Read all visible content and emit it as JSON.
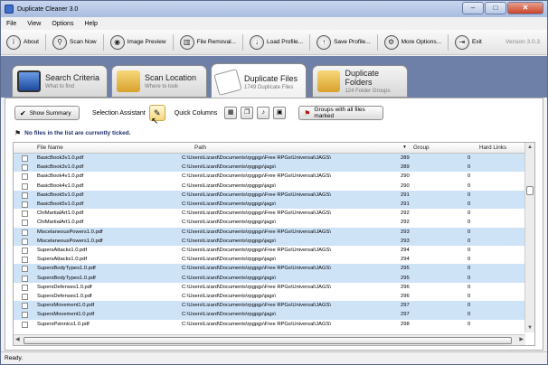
{
  "window": {
    "title": "Duplicate Cleaner 3.0",
    "buttons": [
      "–",
      "□",
      "✕"
    ]
  },
  "menu": [
    "File",
    "View",
    "Options",
    "Help"
  ],
  "toolbar": {
    "items": [
      {
        "label": "About",
        "icon": "info-icon"
      },
      {
        "label": "Scan Now",
        "icon": "magnifier-icon"
      },
      {
        "label": "Image Preview",
        "icon": "eye-icon"
      },
      {
        "label": "File Removal...",
        "icon": "trash-icon"
      },
      {
        "label": "Load Profile...",
        "icon": "down-arrow-icon"
      },
      {
        "label": "Save Profile...",
        "icon": "up-arrow-icon"
      },
      {
        "label": "More Options...",
        "icon": "gear-icon"
      },
      {
        "label": "Exit",
        "icon": "exit-icon"
      }
    ],
    "version": "Version 3.0.3"
  },
  "tabs": [
    {
      "name": "Search Criteria",
      "sub": "What to find",
      "color": "#2a5fb8"
    },
    {
      "name": "Scan Location",
      "sub": "Where to look",
      "color": "#e5b84a"
    },
    {
      "name": "Duplicate Files",
      "sub": "1749 Duplicate Files",
      "color": "#e8e8e8"
    },
    {
      "name": "Duplicate Folders",
      "sub": "124 Folder Groups",
      "color": "#e5b84a"
    }
  ],
  "options": {
    "show_summary": "Show Summary",
    "selection_assistant": "Selection Assistant",
    "quick_columns": "Quick Columns",
    "groups_button": "Groups with all files marked"
  },
  "ticked_message": "No files in the list are currently ticked.",
  "grid": {
    "headers": {
      "file": "File Name",
      "path": "Path",
      "group": "Group",
      "hardlinks": "Hard Links"
    },
    "rows": [
      {
        "file": "BasicBook3v1.0.pdf",
        "path": "C:\\Users\\Lizard\\Documents\\rpgpgs\\Free RPGs\\Universal\\JAGS\\",
        "group": "289",
        "hl": "0",
        "sel": true
      },
      {
        "file": "BasicBook3v1.0.pdf",
        "path": "C:\\Users\\Lizard\\Documents\\rpgpgs\\jags\\",
        "group": "289",
        "hl": "0",
        "sel": true
      },
      {
        "file": "BasicBook4v1.0.pdf",
        "path": "C:\\Users\\Lizard\\Documents\\rpgpgs\\Free RPGs\\Universal\\JAGS\\",
        "group": "290",
        "hl": "0",
        "sel": false
      },
      {
        "file": "BasicBook4v1.0.pdf",
        "path": "C:\\Users\\Lizard\\Documents\\rpgpgs\\jags\\",
        "group": "290",
        "hl": "0",
        "sel": false
      },
      {
        "file": "BasicBook5v1.0.pdf",
        "path": "C:\\Users\\Lizard\\Documents\\rpgpgs\\Free RPGs\\Universal\\JAGS\\",
        "group": "291",
        "hl": "0",
        "sel": true
      },
      {
        "file": "BasicBook5v1.0.pdf",
        "path": "C:\\Users\\Lizard\\Documents\\rpgpgs\\jags\\",
        "group": "291",
        "hl": "0",
        "sel": true
      },
      {
        "file": "ChiMartialArt1.0.pdf",
        "path": "C:\\Users\\Lizard\\Documents\\rpgpgs\\Free RPGs\\Universal\\JAGS\\",
        "group": "292",
        "hl": "0",
        "sel": false
      },
      {
        "file": "ChiMartialArt1.0.pdf",
        "path": "C:\\Users\\Lizard\\Documents\\rpgpgs\\jags\\",
        "group": "292",
        "hl": "0",
        "sel": false
      },
      {
        "file": "MiscelaneousPowers1.0.pdf",
        "path": "C:\\Users\\Lizard\\Documents\\rpgpgs\\Free RPGs\\Universal\\JAGS\\",
        "group": "293",
        "hl": "0",
        "sel": true
      },
      {
        "file": "MiscelaneousPowers1.0.pdf",
        "path": "C:\\Users\\Lizard\\Documents\\rpgpgs\\jags\\",
        "group": "293",
        "hl": "0",
        "sel": true
      },
      {
        "file": "SupersAttacks1.0.pdf",
        "path": "C:\\Users\\Lizard\\Documents\\rpgpgs\\Free RPGs\\Universal\\JAGS\\",
        "group": "294",
        "hl": "0",
        "sel": false
      },
      {
        "file": "SupersAttacks1.0.pdf",
        "path": "C:\\Users\\Lizard\\Documents\\rpgpgs\\jags\\",
        "group": "294",
        "hl": "0",
        "sel": false
      },
      {
        "file": "SupersBodyTypes1.0.pdf",
        "path": "C:\\Users\\Lizard\\Documents\\rpgpgs\\Free RPGs\\Universal\\JAGS\\",
        "group": "295",
        "hl": "0",
        "sel": true
      },
      {
        "file": "SupersBodyTypes1.0.pdf",
        "path": "C:\\Users\\Lizard\\Documents\\rpgpgs\\jags\\",
        "group": "295",
        "hl": "0",
        "sel": true
      },
      {
        "file": "SupersDefenses1.0.pdf",
        "path": "C:\\Users\\Lizard\\Documents\\rpgpgs\\Free RPGs\\Universal\\JAGS\\",
        "group": "296",
        "hl": "0",
        "sel": false
      },
      {
        "file": "SupersDefenses1.0.pdf",
        "path": "C:\\Users\\Lizard\\Documents\\rpgpgs\\jags\\",
        "group": "296",
        "hl": "0",
        "sel": false
      },
      {
        "file": "SupersMovement1.0.pdf",
        "path": "C:\\Users\\Lizard\\Documents\\rpgpgs\\Free RPGs\\Universal\\JAGS\\",
        "group": "297",
        "hl": "0",
        "sel": true
      },
      {
        "file": "SupersMovement1.0.pdf",
        "path": "C:\\Users\\Lizard\\Documents\\rpgpgs\\jags\\",
        "group": "297",
        "hl": "0",
        "sel": true
      },
      {
        "file": "SupersPsionics1.0.pdf",
        "path": "C:\\Users\\Lizard\\Documents\\rpgpgs\\Free RPGs\\Universal\\JAGS\\",
        "group": "298",
        "hl": "0",
        "sel": false
      }
    ]
  },
  "status": "Ready."
}
